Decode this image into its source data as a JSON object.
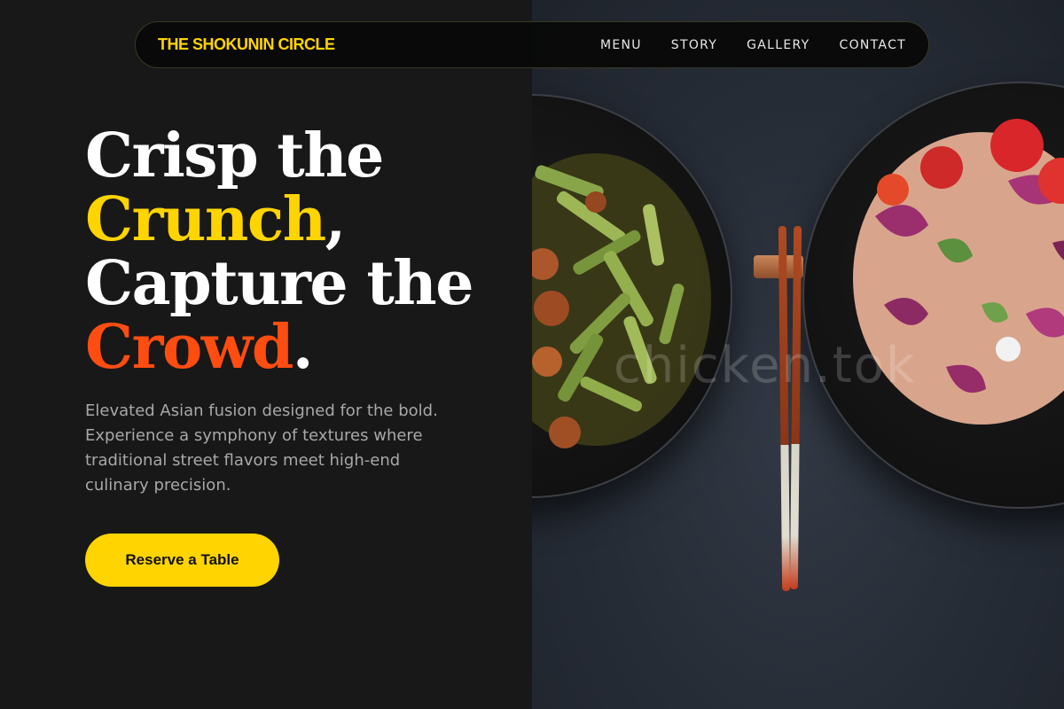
{
  "nav": {
    "brand": "THE SHOKUNIN CIRCLE",
    "links": [
      "MENU",
      "STORY",
      "GALLERY",
      "CONTACT"
    ]
  },
  "hero": {
    "line1": "Crisp the",
    "word_crunch": "Crunch",
    "comma": ",",
    "line3": "Capture the",
    "word_crowd": "Crowd",
    "period": ".",
    "description": "Elevated Asian fusion designed for the bold. Experience a symphony of textures where traditional street flavors meet high-end culinary precision.",
    "cta_label": "Reserve a Table"
  },
  "image": {
    "watermark": "chicken.tok"
  },
  "colors": {
    "accent_yellow": "#ffd400",
    "accent_orange": "#ff4d12",
    "background": "#181818"
  },
  "icons": [
    "chopsticks-icon",
    "bowl-icon"
  ]
}
